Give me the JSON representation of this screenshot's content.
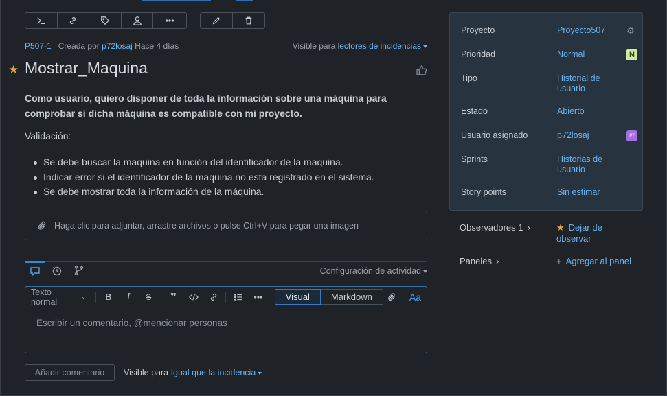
{
  "toolbar": {
    "group1": [
      "shortcut-icon",
      "link-icon",
      "tag-icon",
      "assign-icon",
      "more-icon"
    ],
    "group2": [
      "edit-icon",
      "delete-icon"
    ]
  },
  "issue": {
    "key": "P507-1",
    "created_by_label": "Creada por",
    "author": "p72losaj",
    "time_ago": "Hace 4 días",
    "visibility_label": "Visible para",
    "visibility_value": "lectores de incidencias",
    "title": "Mostrar_Maquina",
    "description_bold": "Como usuario, quiero disponer de toda la información sobre una máquina para comprobar si dicha máquina es compatible con mi proyecto.",
    "validation_label": "Validación:",
    "validation_items": [
      "Se debe buscar la maquina en función del identificador de la maquina.",
      "Indicar error si el identificador de la maquina no esta registrado en el sistema.",
      "Se debe mostrar toda la información de la máquina."
    ],
    "attach_text": "Haga clic para adjuntar, arrastre archivos o pulse Ctrl+V para pegar una imagen"
  },
  "activity": {
    "config_label": "Configuración de actividad"
  },
  "editor": {
    "text_style": "Texto normal",
    "mode_visual": "Visual",
    "mode_markdown": "Markdown",
    "aa": "Aa",
    "placeholder": "Escribir un comentario, @mencionar personas",
    "add_comment": "Añadir comentario",
    "visible_label": "Visible para",
    "visible_value": "Igual que la incidencia"
  },
  "side": {
    "fields": [
      {
        "label": "Proyecto",
        "value": "Proyecto507"
      },
      {
        "label": "Prioridad",
        "value": "Normal",
        "badge": "N"
      },
      {
        "label": "Tipo",
        "value": "Historial de usuario"
      },
      {
        "label": "Estado",
        "value": "Abierto"
      },
      {
        "label": "Usuario asignado",
        "value": "p72losaj",
        "avatar": "P7"
      },
      {
        "label": "Sprints",
        "value": "Historias de usuario"
      },
      {
        "label": "Story points",
        "value": "Sin estimar"
      }
    ],
    "watchers_label": "Observadores",
    "watchers_count": "1",
    "unwatch_action": "Dejar de observar",
    "panels_label": "Paneles",
    "add_panel_action": "Agregar al panel"
  },
  "colors": {
    "accent": "#6cb2ef",
    "star": "#e8a33d",
    "panel_bg": "#283340"
  }
}
